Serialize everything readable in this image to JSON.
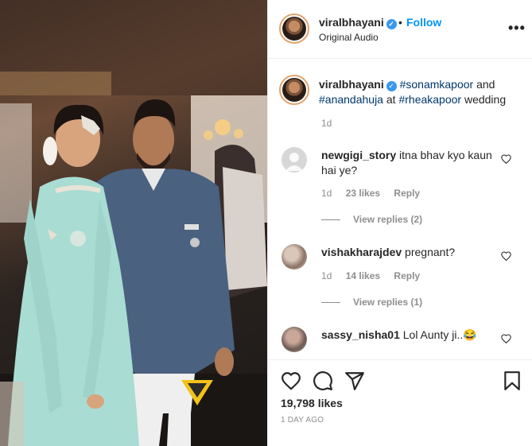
{
  "post": {
    "username": "viralbhayani",
    "verified_icon": "verified-badge-icon",
    "separator": "•",
    "follow_label": "Follow",
    "subtitle": "Original Audio",
    "more_icon": "more-options-icon",
    "more_label": "•••"
  },
  "caption": {
    "username": "viralbhayani",
    "tag1": "#sonamkapoor",
    "and": " and",
    "tag2": "#anandahuja",
    "at": " at ",
    "tag3": "#rheakapoor",
    "tail": " wedding",
    "time": "1d"
  },
  "comments": [
    {
      "username": "newgigi_story",
      "text": " itna bhav kyo kaun hai ye?",
      "time": "1d",
      "likes": "23 likes",
      "reply": "Reply",
      "view_replies": "View replies (2)"
    },
    {
      "username": "vishakharajdev",
      "text": " pregnant?",
      "time": "1d",
      "likes": "14 likes",
      "reply": "Reply",
      "view_replies": "View replies (1)"
    },
    {
      "username": "sassy_nisha01",
      "text": " Lol Aunty ji..😂"
    }
  ],
  "footer": {
    "likes": "19,798 likes",
    "date": "1 DAY AGO"
  },
  "colors": {
    "link": "#0095f6",
    "hashtag": "#00376b",
    "muted": "#8e8e8e"
  }
}
